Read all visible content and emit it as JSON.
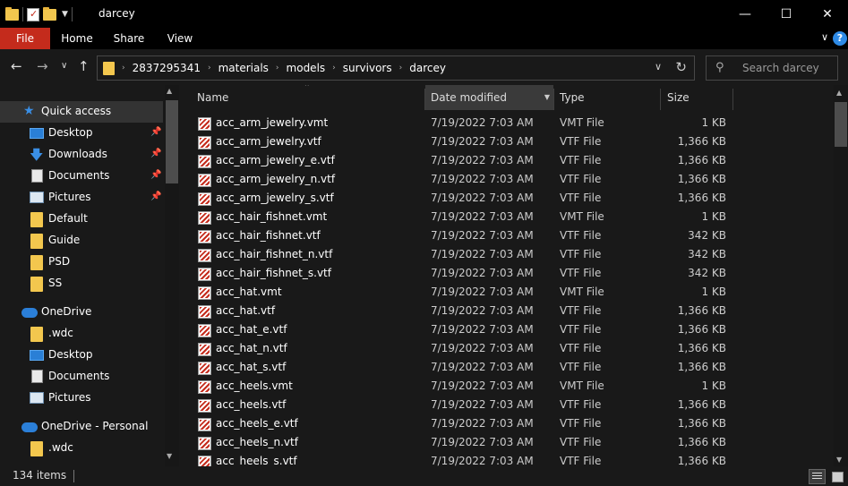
{
  "window": {
    "title": "darcey",
    "minimize_glyph": "—",
    "maximize_glyph": "☐",
    "close_glyph": "✕"
  },
  "ribbon": {
    "tabs": [
      "File",
      "Home",
      "Share",
      "View"
    ],
    "expand_glyph": "∨",
    "help_glyph": "?"
  },
  "nav": {
    "back_glyph": "←",
    "forward_glyph": "→",
    "recent_glyph": "∨",
    "up_glyph": "↑",
    "breadcrumb": [
      "2837295341",
      "materials",
      "models",
      "survivors",
      "darcey"
    ],
    "crumb_sep": "›",
    "dropdown_glyph": "∨",
    "refresh_glyph": "↻",
    "search_placeholder": "Search darcey"
  },
  "sidebar": {
    "quick_access": "Quick access",
    "qa_items": [
      "Desktop",
      "Downloads",
      "Documents",
      "Pictures",
      "Default",
      "Guide",
      "PSD",
      "SS"
    ],
    "onedrive": "OneDrive",
    "od_items": [
      ".wdc",
      "Desktop",
      "Documents",
      "Pictures"
    ],
    "onedrive_personal": "OneDrive - Personal",
    "odp_items": [
      ".wdc"
    ]
  },
  "columns": {
    "name": "Name",
    "date": "Date modified",
    "type": "Type",
    "size": "Size"
  },
  "files": [
    {
      "name": "acc_arm_jewelry.vmt",
      "date": "7/19/2022 7:03 AM",
      "type": "VMT File",
      "size": "1 KB"
    },
    {
      "name": "acc_arm_jewelry.vtf",
      "date": "7/19/2022 7:03 AM",
      "type": "VTF File",
      "size": "1,366 KB"
    },
    {
      "name": "acc_arm_jewelry_e.vtf",
      "date": "7/19/2022 7:03 AM",
      "type": "VTF File",
      "size": "1,366 KB"
    },
    {
      "name": "acc_arm_jewelry_n.vtf",
      "date": "7/19/2022 7:03 AM",
      "type": "VTF File",
      "size": "1,366 KB"
    },
    {
      "name": "acc_arm_jewelry_s.vtf",
      "date": "7/19/2022 7:03 AM",
      "type": "VTF File",
      "size": "1,366 KB"
    },
    {
      "name": "acc_hair_fishnet.vmt",
      "date": "7/19/2022 7:03 AM",
      "type": "VMT File",
      "size": "1 KB"
    },
    {
      "name": "acc_hair_fishnet.vtf",
      "date": "7/19/2022 7:03 AM",
      "type": "VTF File",
      "size": "342 KB"
    },
    {
      "name": "acc_hair_fishnet_n.vtf",
      "date": "7/19/2022 7:03 AM",
      "type": "VTF File",
      "size": "342 KB"
    },
    {
      "name": "acc_hair_fishnet_s.vtf",
      "date": "7/19/2022 7:03 AM",
      "type": "VTF File",
      "size": "342 KB"
    },
    {
      "name": "acc_hat.vmt",
      "date": "7/19/2022 7:03 AM",
      "type": "VMT File",
      "size": "1 KB"
    },
    {
      "name": "acc_hat.vtf",
      "date": "7/19/2022 7:03 AM",
      "type": "VTF File",
      "size": "1,366 KB"
    },
    {
      "name": "acc_hat_e.vtf",
      "date": "7/19/2022 7:03 AM",
      "type": "VTF File",
      "size": "1,366 KB"
    },
    {
      "name": "acc_hat_n.vtf",
      "date": "7/19/2022 7:03 AM",
      "type": "VTF File",
      "size": "1,366 KB"
    },
    {
      "name": "acc_hat_s.vtf",
      "date": "7/19/2022 7:03 AM",
      "type": "VTF File",
      "size": "1,366 KB"
    },
    {
      "name": "acc_heels.vmt",
      "date": "7/19/2022 7:03 AM",
      "type": "VMT File",
      "size": "1 KB"
    },
    {
      "name": "acc_heels.vtf",
      "date": "7/19/2022 7:03 AM",
      "type": "VTF File",
      "size": "1,366 KB"
    },
    {
      "name": "acc_heels_e.vtf",
      "date": "7/19/2022 7:03 AM",
      "type": "VTF File",
      "size": "1,366 KB"
    },
    {
      "name": "acc_heels_n.vtf",
      "date": "7/19/2022 7:03 AM",
      "type": "VTF File",
      "size": "1,366 KB"
    },
    {
      "name": "acc_heels_s.vtf",
      "date": "7/19/2022 7:03 AM",
      "type": "VTF File",
      "size": "1,366 KB"
    }
  ],
  "status": {
    "item_count": "134 items"
  },
  "colors": {
    "accent_file_tab": "#c42b1c",
    "folder": "#f3c74e",
    "link_blue": "#2e8ae6",
    "background": "#191919"
  }
}
